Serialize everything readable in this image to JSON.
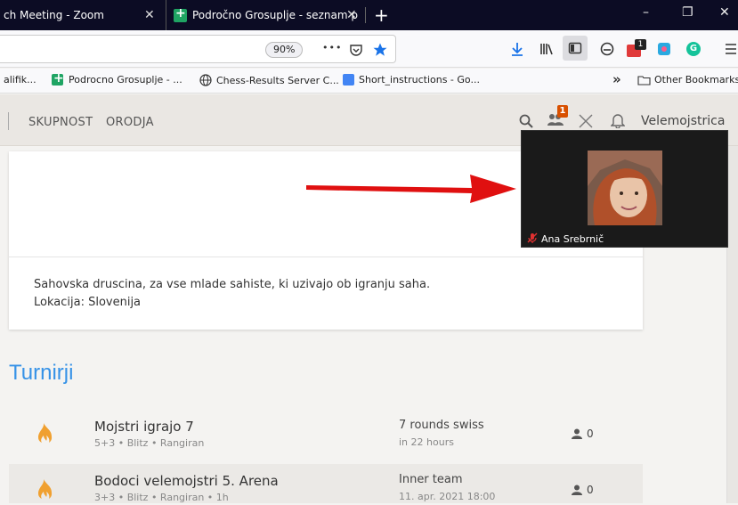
{
  "tabs": [
    {
      "title": "ch Meeting - Zoom",
      "close": "✕"
    },
    {
      "title": "Področno Grosuplje - seznam p",
      "close": "✕"
    }
  ],
  "window": {
    "minimize": "–",
    "restore": "❐",
    "close": "✕"
  },
  "navbar": {
    "zoom": "90%",
    "more": "•••",
    "badge": "1"
  },
  "bookmarks": {
    "items": [
      {
        "label": "alifik..."
      },
      {
        "label": "Podrocno Grosuplje - ..."
      },
      {
        "label": "Chess-Results Server C..."
      },
      {
        "label": "Short_instructions - Go..."
      }
    ],
    "overflow": "»",
    "other": "Other Bookmarks"
  },
  "site": {
    "menu": [
      "SKUPNOST",
      "ORODJA"
    ],
    "notif_badge": "1",
    "username": "Velemojstrica"
  },
  "profile": {
    "description": "Sahovska druscina, za vse mlade sahiste, ki uzivajo ob igranju saha.",
    "location": "Lokacija: Slovenija"
  },
  "tournaments_title": "Turnirji",
  "tournaments": [
    {
      "name": "Mojstri igrajo 7",
      "meta": "5+3 • Blitz • Rangiran",
      "info1": "7 rounds swiss",
      "info2": "in 22 hours",
      "players": "0"
    },
    {
      "name": "Bodoci velemojstri 5. Arena",
      "meta": "3+3 • Blitz • Rangiran • 1h",
      "info1": "Inner team",
      "info2": "11. apr. 2021 18:00",
      "players": "0"
    }
  ],
  "zoom_popup": {
    "participant": "Ana Srebrnič"
  },
  "colors": {
    "accent": "#3692e7",
    "flame": "#f0a030",
    "arrow": "#e01010",
    "tabbar": "#0c0c24"
  }
}
